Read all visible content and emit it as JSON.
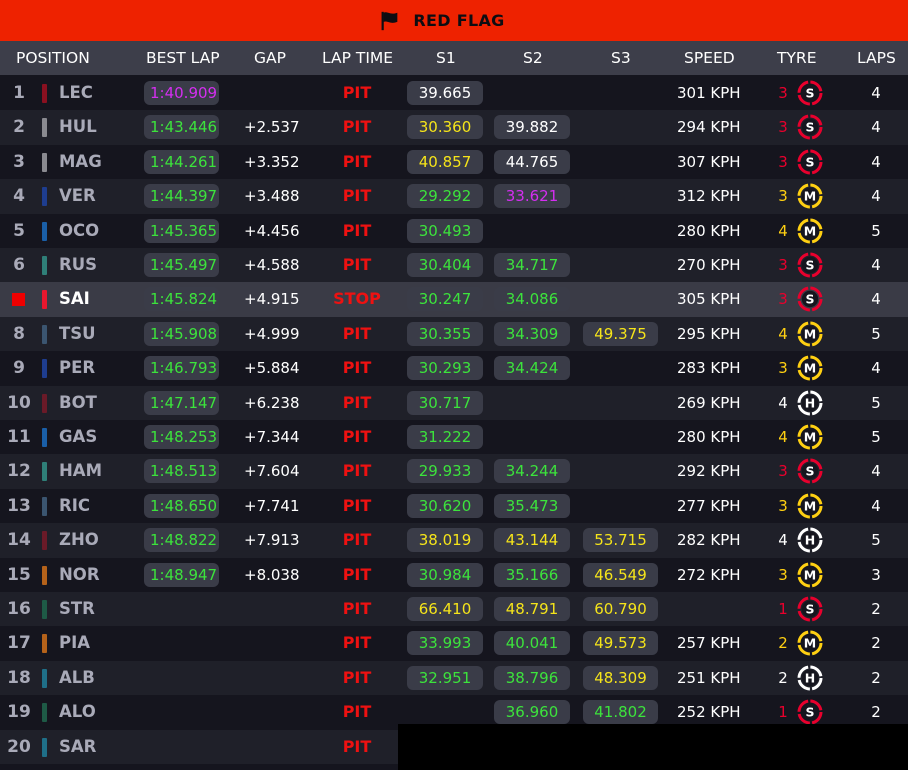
{
  "banner": {
    "title": "RED FLAG",
    "icon": "checkered-flag-icon"
  },
  "columns": {
    "position": "POSITION",
    "best_lap": "BEST LAP",
    "gap": "GAP",
    "lap_time": "LAP TIME",
    "s1": "S1",
    "s2": "S2",
    "s3": "S3",
    "speed": "SPEED",
    "tyre": "TYRE",
    "laps": "LAPS"
  },
  "colors": {
    "purple": "#d42ef0",
    "green": "#3ce33c",
    "yellow": "#f5e41a",
    "red": "#ee1111",
    "soft": "#e8002d",
    "medium": "#ffd012",
    "hard": "#ffffff"
  },
  "rows": [
    {
      "pos": "1",
      "code": "LEC",
      "team_color": "#8a1020",
      "best_lap": "1:40.909",
      "best_lap_color": "purple",
      "gap": "",
      "status": "PIT",
      "s1": "39.665",
      "s1_color": "white",
      "s2": "",
      "s2_color": "",
      "s3": "",
      "s3_color": "",
      "speed": "301 KPH",
      "tyre_count": "3",
      "tyre": "S",
      "laps": "4"
    },
    {
      "pos": "2",
      "code": "HUL",
      "team_color": "#8a8a90",
      "best_lap": "1:43.446",
      "best_lap_color": "green",
      "gap": "+2.537",
      "status": "PIT",
      "s1": "30.360",
      "s1_color": "yellow",
      "s2": "39.882",
      "s2_color": "white",
      "s3": "",
      "s3_color": "",
      "speed": "294 KPH",
      "tyre_count": "3",
      "tyre": "S",
      "laps": "4"
    },
    {
      "pos": "3",
      "code": "MAG",
      "team_color": "#8a8a90",
      "best_lap": "1:44.261",
      "best_lap_color": "green",
      "gap": "+3.352",
      "status": "PIT",
      "s1": "40.857",
      "s1_color": "yellow",
      "s2": "44.765",
      "s2_color": "white",
      "s3": "",
      "s3_color": "",
      "speed": "307 KPH",
      "tyre_count": "3",
      "tyre": "S",
      "laps": "4"
    },
    {
      "pos": "4",
      "code": "VER",
      "team_color": "#1e3d8f",
      "best_lap": "1:44.397",
      "best_lap_color": "green",
      "gap": "+3.488",
      "status": "PIT",
      "s1": "29.292",
      "s1_color": "green",
      "s2": "33.621",
      "s2_color": "purple",
      "s3": "",
      "s3_color": "",
      "speed": "312 KPH",
      "tyre_count": "3",
      "tyre": "M",
      "laps": "4"
    },
    {
      "pos": "5",
      "code": "OCO",
      "team_color": "#1a5fa8",
      "best_lap": "1:45.365",
      "best_lap_color": "green",
      "gap": "+4.456",
      "status": "PIT",
      "s1": "30.493",
      "s1_color": "green",
      "s2": "",
      "s2_color": "",
      "s3": "",
      "s3_color": "",
      "speed": "280 KPH",
      "tyre_count": "4",
      "tyre": "M",
      "laps": "5"
    },
    {
      "pos": "6",
      "code": "RUS",
      "team_color": "#2f7f78",
      "best_lap": "1:45.497",
      "best_lap_color": "green",
      "gap": "+4.588",
      "status": "PIT",
      "s1": "30.404",
      "s1_color": "green",
      "s2": "34.717",
      "s2_color": "green",
      "s3": "",
      "s3_color": "",
      "speed": "270 KPH",
      "tyre_count": "3",
      "tyre": "S",
      "laps": "4"
    },
    {
      "pos": "7",
      "code": "SAI",
      "team_color": "#e8172e",
      "best_lap": "1:45.824",
      "best_lap_color": "green",
      "gap": "+4.915",
      "status": "STOP",
      "s1": "30.247",
      "s1_color": "green",
      "s2": "34.086",
      "s2_color": "green",
      "s3": "",
      "s3_color": "",
      "speed": "305 KPH",
      "tyre_count": "3",
      "tyre": "S",
      "laps": "4"
    },
    {
      "pos": "8",
      "code": "TSU",
      "team_color": "#3b5570",
      "best_lap": "1:45.908",
      "best_lap_color": "green",
      "gap": "+4.999",
      "status": "PIT",
      "s1": "30.355",
      "s1_color": "green",
      "s2": "34.309",
      "s2_color": "green",
      "s3": "49.375",
      "s3_color": "yellow",
      "speed": "295 KPH",
      "tyre_count": "4",
      "tyre": "M",
      "laps": "5"
    },
    {
      "pos": "9",
      "code": "PER",
      "team_color": "#1e3d8f",
      "best_lap": "1:46.793",
      "best_lap_color": "green",
      "gap": "+5.884",
      "status": "PIT",
      "s1": "30.293",
      "s1_color": "green",
      "s2": "34.424",
      "s2_color": "green",
      "s3": "",
      "s3_color": "",
      "speed": "283 KPH",
      "tyre_count": "3",
      "tyre": "M",
      "laps": "4"
    },
    {
      "pos": "10",
      "code": "BOT",
      "team_color": "#6a1a28",
      "best_lap": "1:47.147",
      "best_lap_color": "green",
      "gap": "+6.238",
      "status": "PIT",
      "s1": "30.717",
      "s1_color": "green",
      "s2": "",
      "s2_color": "",
      "s3": "",
      "s3_color": "",
      "speed": "269 KPH",
      "tyre_count": "4",
      "tyre": "H",
      "laps": "5"
    },
    {
      "pos": "11",
      "code": "GAS",
      "team_color": "#1a5fa8",
      "best_lap": "1:48.253",
      "best_lap_color": "green",
      "gap": "+7.344",
      "status": "PIT",
      "s1": "31.222",
      "s1_color": "green",
      "s2": "",
      "s2_color": "",
      "s3": "",
      "s3_color": "",
      "speed": "280 KPH",
      "tyre_count": "4",
      "tyre": "M",
      "laps": "5"
    },
    {
      "pos": "12",
      "code": "HAM",
      "team_color": "#2f7f78",
      "best_lap": "1:48.513",
      "best_lap_color": "green",
      "gap": "+7.604",
      "status": "PIT",
      "s1": "29.933",
      "s1_color": "green",
      "s2": "34.244",
      "s2_color": "green",
      "s3": "",
      "s3_color": "",
      "speed": "292 KPH",
      "tyre_count": "3",
      "tyre": "S",
      "laps": "4"
    },
    {
      "pos": "13",
      "code": "RIC",
      "team_color": "#3b5570",
      "best_lap": "1:48.650",
      "best_lap_color": "green",
      "gap": "+7.741",
      "status": "PIT",
      "s1": "30.620",
      "s1_color": "green",
      "s2": "35.473",
      "s2_color": "green",
      "s3": "",
      "s3_color": "",
      "speed": "277 KPH",
      "tyre_count": "3",
      "tyre": "M",
      "laps": "4"
    },
    {
      "pos": "14",
      "code": "ZHO",
      "team_color": "#6a1a28",
      "best_lap": "1:48.822",
      "best_lap_color": "green",
      "gap": "+7.913",
      "status": "PIT",
      "s1": "38.019",
      "s1_color": "yellow",
      "s2": "43.144",
      "s2_color": "yellow",
      "s3": "53.715",
      "s3_color": "yellow",
      "speed": "282 KPH",
      "tyre_count": "4",
      "tyre": "H",
      "laps": "5"
    },
    {
      "pos": "15",
      "code": "NOR",
      "team_color": "#b5621a",
      "best_lap": "1:48.947",
      "best_lap_color": "green",
      "gap": "+8.038",
      "status": "PIT",
      "s1": "30.984",
      "s1_color": "green",
      "s2": "35.166",
      "s2_color": "green",
      "s3": "46.549",
      "s3_color": "yellow",
      "speed": "272 KPH",
      "tyre_count": "3",
      "tyre": "M",
      "laps": "3"
    },
    {
      "pos": "16",
      "code": "STR",
      "team_color": "#1e5a46",
      "best_lap": "",
      "best_lap_color": "",
      "gap": "",
      "status": "PIT",
      "s1": "66.410",
      "s1_color": "yellow",
      "s2": "48.791",
      "s2_color": "yellow",
      "s3": "60.790",
      "s3_color": "yellow",
      "speed": "",
      "tyre_count": "1",
      "tyre": "S",
      "laps": "2"
    },
    {
      "pos": "17",
      "code": "PIA",
      "team_color": "#b5621a",
      "best_lap": "",
      "best_lap_color": "",
      "gap": "",
      "status": "PIT",
      "s1": "33.993",
      "s1_color": "green",
      "s2": "40.041",
      "s2_color": "green",
      "s3": "49.573",
      "s3_color": "yellow",
      "speed": "257 KPH",
      "tyre_count": "2",
      "tyre": "M",
      "laps": "2"
    },
    {
      "pos": "18",
      "code": "ALB",
      "team_color": "#1f6f88",
      "best_lap": "",
      "best_lap_color": "",
      "gap": "",
      "status": "PIT",
      "s1": "32.951",
      "s1_color": "green",
      "s2": "38.796",
      "s2_color": "green",
      "s3": "48.309",
      "s3_color": "yellow",
      "speed": "251 KPH",
      "tyre_count": "2",
      "tyre": "H",
      "laps": "2"
    },
    {
      "pos": "19",
      "code": "ALO",
      "team_color": "#1e5a46",
      "best_lap": "",
      "best_lap_color": "",
      "gap": "",
      "status": "PIT",
      "s1": "",
      "s1_color": "",
      "s2": "36.960",
      "s2_color": "green",
      "s3": "41.802",
      "s3_color": "green",
      "speed": "252 KPH",
      "tyre_count": "1",
      "tyre": "S",
      "laps": "2"
    },
    {
      "pos": "20",
      "code": "SAR",
      "team_color": "#1f6f88",
      "best_lap": "",
      "best_lap_color": "",
      "gap": "",
      "status": "PIT",
      "s1": "",
      "s1_color": "",
      "s2": "",
      "s2_color": "",
      "s3": "",
      "s3_color": "",
      "speed": "",
      "tyre_count": "",
      "tyre": "",
      "laps": ""
    }
  ]
}
